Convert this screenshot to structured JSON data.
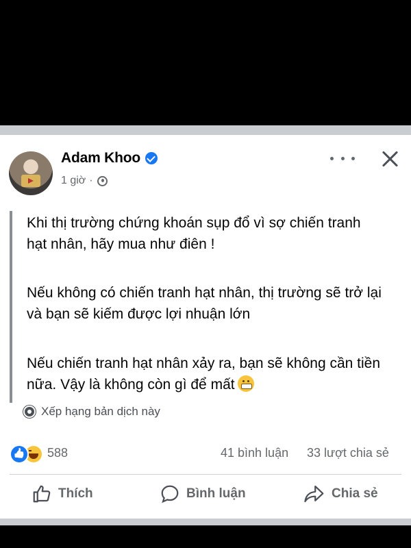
{
  "post": {
    "author": "Adam Khoo",
    "time": "1 giờ",
    "separator": "·",
    "paragraphs": [
      "Khi thị trường chứng khoán sụp đổ vì sợ chiến tranh hạt nhân, hãy mua như điên !",
      "Nếu không có chiến tranh hạt nhân, thị trường sẽ trở lại và bạn sẽ kiếm được lợi nhuận lớn",
      "Nếu chiến tranh hạt nhân xảy ra, bạn sẽ không cần tiền nữa. Vậy là không còn gì để mất"
    ],
    "rate_translation": "Xếp hạng bản dịch này"
  },
  "stats": {
    "reactions": "588",
    "comments": "41 bình luận",
    "shares": "33 lượt chia sẻ"
  },
  "actions": {
    "like": "Thích",
    "comment": "Bình luận",
    "share": "Chia sẻ"
  },
  "icons": [
    "verified-icon",
    "globe-icon",
    "more-icon",
    "close-icon",
    "gear-icon",
    "like-reaction-icon",
    "haha-reaction-icon",
    "thumbs-up-icon",
    "comment-icon",
    "share-icon",
    "grimace-emoji-icon"
  ],
  "colors": {
    "accent": "#1877f2",
    "secondary_text": "#65676b",
    "background": "#ffffff"
  }
}
